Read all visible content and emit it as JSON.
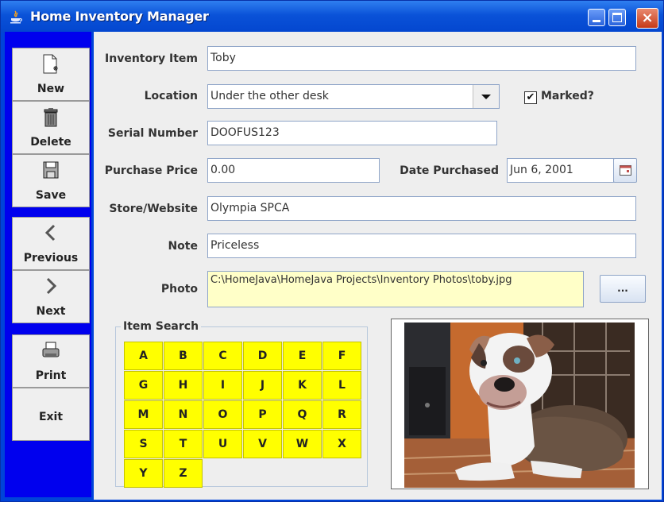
{
  "window": {
    "title": "Home Inventory Manager",
    "close_glyph": "×"
  },
  "sidebar": {
    "new_label": "New",
    "delete_label": "Delete",
    "save_label": "Save",
    "previous_label": "Previous",
    "next_label": "Next",
    "print_label": "Print",
    "exit_label": "Exit"
  },
  "form": {
    "inventory_item_label": "Inventory Item",
    "inventory_item_value": "Toby",
    "location_label": "Location",
    "location_value": "Under the other desk",
    "marked_label": "Marked?",
    "marked_checked": true,
    "marked_glyph": "✔",
    "serial_label": "Serial Number",
    "serial_value": "DOOFUS123",
    "price_label": "Purchase Price",
    "price_value": "0.00",
    "date_label": "Date Purchased",
    "date_value": "Jun 6, 2001",
    "store_label": "Store/Website",
    "store_value": "Olympia SPCA",
    "note_label": "Note",
    "note_value": "Priceless",
    "photo_label": "Photo",
    "photo_path": "C:\\HomeJava\\HomeJava Projects\\Inventory Photos\\toby.jpg",
    "browse_label": "..."
  },
  "search": {
    "title": "Item Search",
    "letters": [
      "A",
      "B",
      "C",
      "D",
      "E",
      "F",
      "G",
      "H",
      "I",
      "J",
      "K",
      "L",
      "M",
      "N",
      "O",
      "P",
      "Q",
      "R",
      "S",
      "T",
      "U",
      "V",
      "W",
      "X",
      "Y",
      "Z"
    ]
  },
  "colors": {
    "sidebar_bg": "#0000ee",
    "letter_bg": "#ffff00",
    "photo_field_bg": "#ffffc8"
  }
}
